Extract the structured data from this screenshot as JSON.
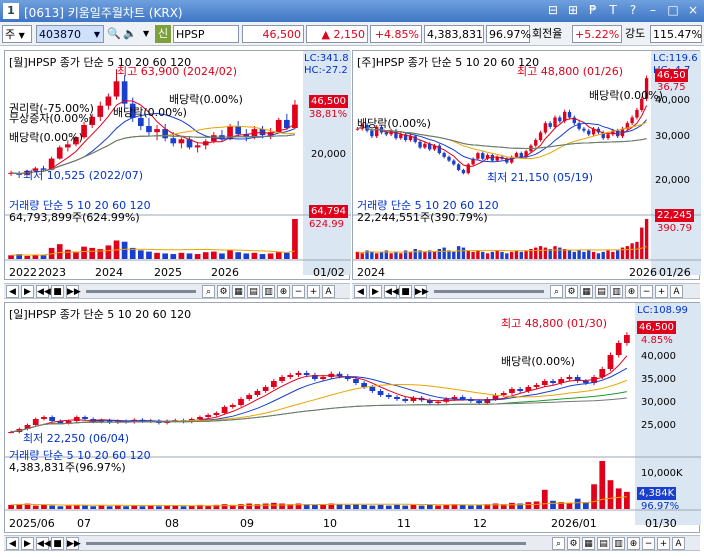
{
  "window": {
    "number": "1",
    "title": "[0613] 키움일주월차트 (KRX)",
    "buttons": [
      "⊟",
      "⊞",
      "₱",
      "T",
      "?",
      "–",
      "□",
      "×"
    ]
  },
  "toolbar": {
    "mode": "주",
    "code": "403870",
    "credit_badge": "신",
    "stock_name": "HPSP",
    "price": "46,500",
    "change": "2,150",
    "change_pct": "+4.85%",
    "volume": "4,383,831",
    "volume_ratio": "96.97%",
    "turnover_label": "회전율",
    "turnover": "+5.22%",
    "strength_label": "강도",
    "strength": "115.47%"
  },
  "monthly": {
    "header": "[월]HPSP 종가 단순 5 10 20 60 120",
    "high_label": "최고 63,900 (2024/02)",
    "low_label": "최저 10,525 (2022/07)",
    "dividend_labels": [
      "배당락(0.00%)",
      "배당락(0.00%)"
    ],
    "left_labels": [
      "권리락(-75.00%)",
      "무상증자(0.00%)",
      "배당락(0.00%)"
    ],
    "lc": "LC:341.8",
    "hc": "HC:-27.2",
    "price_tag": "46,500",
    "pct_tag": "38,81%",
    "y_ticks": [
      "20,000"
    ],
    "vol_header": "거래량 단순 5 10 20 60 120",
    "vol_value": "64,793,899주(624.99%)",
    "vol_tag": "64,794",
    "vol_pct_tag": "624.99",
    "x_ticks": [
      "2022",
      "2023",
      "2024",
      "2025",
      "2026"
    ],
    "date": "01/02",
    "candles": [
      {
        "o": 12500,
        "h": 14000,
        "l": 11500,
        "c": 13000
      },
      {
        "o": 13000,
        "h": 13800,
        "l": 10525,
        "c": 12000
      },
      {
        "o": 12000,
        "h": 14500,
        "l": 11800,
        "c": 14000
      },
      {
        "o": 14000,
        "h": 16000,
        "l": 13200,
        "c": 15200
      },
      {
        "o": 15200,
        "h": 16500,
        "l": 14000,
        "c": 14500
      },
      {
        "o": 14500,
        "h": 21000,
        "l": 14200,
        "c": 20000
      },
      {
        "o": 20000,
        "h": 26500,
        "l": 19500,
        "c": 25500
      },
      {
        "o": 25500,
        "h": 29000,
        "l": 23500,
        "c": 27000
      },
      {
        "o": 27000,
        "h": 31000,
        "l": 26000,
        "c": 30500
      },
      {
        "o": 30500,
        "h": 38000,
        "l": 29800,
        "c": 36500
      },
      {
        "o": 36500,
        "h": 42000,
        "l": 35000,
        "c": 40500
      },
      {
        "o": 40500,
        "h": 48000,
        "l": 38500,
        "c": 46000
      },
      {
        "o": 46000,
        "h": 52000,
        "l": 44000,
        "c": 50500
      },
      {
        "o": 50500,
        "h": 63900,
        "l": 49000,
        "c": 58000
      },
      {
        "o": 58000,
        "h": 61000,
        "l": 45000,
        "c": 47000
      },
      {
        "o": 47000,
        "h": 50000,
        "l": 38000,
        "c": 40000
      },
      {
        "o": 40000,
        "h": 43000,
        "l": 34000,
        "c": 36000
      },
      {
        "o": 36000,
        "h": 40000,
        "l": 31000,
        "c": 33000
      },
      {
        "o": 33000,
        "h": 36500,
        "l": 29000,
        "c": 34500
      },
      {
        "o": 34500,
        "h": 37000,
        "l": 28500,
        "c": 30000
      },
      {
        "o": 30000,
        "h": 33000,
        "l": 26000,
        "c": 27500
      },
      {
        "o": 27500,
        "h": 30500,
        "l": 25000,
        "c": 29500
      },
      {
        "o": 29500,
        "h": 31000,
        "l": 24500,
        "c": 25500
      },
      {
        "o": 25500,
        "h": 28000,
        "l": 23000,
        "c": 26500
      },
      {
        "o": 26500,
        "h": 29500,
        "l": 24500,
        "c": 28500
      },
      {
        "o": 28500,
        "h": 33000,
        "l": 27500,
        "c": 31500
      },
      {
        "o": 31500,
        "h": 34000,
        "l": 28500,
        "c": 29500
      },
      {
        "o": 29500,
        "h": 37000,
        "l": 29000,
        "c": 36000
      },
      {
        "o": 36000,
        "h": 38500,
        "l": 31000,
        "c": 32000
      },
      {
        "o": 32000,
        "h": 34500,
        "l": 28500,
        "c": 30500
      },
      {
        "o": 30500,
        "h": 36000,
        "l": 29500,
        "c": 34500
      },
      {
        "o": 34500,
        "h": 36000,
        "l": 30000,
        "c": 31500
      },
      {
        "o": 31500,
        "h": 35000,
        "l": 29500,
        "c": 33000
      },
      {
        "o": 33000,
        "h": 40000,
        "l": 32500,
        "c": 39000
      },
      {
        "o": 39000,
        "h": 42000,
        "l": 34000,
        "c": 35000
      },
      {
        "o": 35000,
        "h": 48800,
        "l": 34500,
        "c": 46500
      }
    ],
    "volumes": [
      6,
      8,
      5,
      7,
      6,
      18,
      24,
      15,
      12,
      20,
      18,
      16,
      22,
      30,
      28,
      18,
      14,
      12,
      10,
      9,
      8,
      10,
      9,
      8,
      11,
      12,
      9,
      14,
      11,
      9,
      10,
      8,
      9,
      12,
      10,
      64.8
    ]
  },
  "weekly": {
    "header": "[주]HPSP 종가 단순 5 10 20 60 120",
    "high_label": "최고 48,800 (01/26)",
    "low_label": "최저 21,150 (05/19)",
    "dividend_labels": [
      "배당락(0.00%)",
      "배당락(0.00%)"
    ],
    "lc": "LC:119.6",
    "hc": "HC:-4.7",
    "price_tag": "46,50",
    "pct_tag": "36,75",
    "y_ticks": [
      "40,000",
      "30,000",
      "20,000"
    ],
    "vol_header": "거래량 단순 5 10 20 60 120",
    "vol_value": "22,244,551주(390.79%)",
    "vol_tag": "22,245",
    "vol_pct_tag": "390.79",
    "x_ticks": [
      "2024",
      "2026"
    ],
    "date": "01/26",
    "closes": [
      33000,
      34000,
      32500,
      31000,
      33500,
      32000,
      31500,
      32500,
      30500,
      31500,
      30000,
      31000,
      29500,
      28000,
      29000,
      27500,
      28500,
      26500,
      25500,
      24500,
      23500,
      22000,
      21150,
      23500,
      25000,
      26500,
      25000,
      26000,
      24500,
      25500,
      25000,
      24000,
      25500,
      26500,
      25500,
      27000,
      28500,
      30000,
      32000,
      34500,
      33500,
      36000,
      35000,
      37500,
      36000,
      34500,
      33000,
      32500,
      31500,
      33000,
      32000,
      30500,
      31500,
      32500,
      31000,
      33000,
      34500,
      36000,
      38000,
      41000,
      46500
    ],
    "volumes": [
      5,
      4,
      6,
      5,
      4,
      5,
      6,
      4,
      5,
      4,
      6,
      5,
      7,
      6,
      5,
      6,
      5,
      7,
      8,
      6,
      5,
      9,
      8,
      6,
      5,
      6,
      5,
      4,
      5,
      6,
      5,
      4,
      5,
      6,
      5,
      6,
      7,
      8,
      9,
      8,
      7,
      9,
      8,
      7,
      6,
      5,
      6,
      5,
      6,
      5,
      4,
      5,
      6,
      5,
      6,
      8,
      9,
      11,
      12,
      22,
      28
    ]
  },
  "daily": {
    "header": "[일]HPSP 종가 단순 5 10 20 60 120",
    "high_label": "최고 48,800 (01/30)",
    "low_label": "최저 22,250 (06/04)",
    "dividend_labels": [
      "배당락(0.00%)"
    ],
    "lc": "LC:108.99",
    "price_tag": "46,500",
    "pct_tag": "4.85%",
    "y_ticks": [
      "40,000",
      "35,000",
      "30,000",
      "25,000"
    ],
    "vol_header": "거래량 단순 5 10 20 60 120",
    "vol_value": "4,383,831주(96.97%)",
    "vol_ticks": [
      "10,000K"
    ],
    "vol_tag": "4,384K",
    "vol_pct_tag": "96.97%",
    "x_ticks": [
      "2025/06",
      "07",
      "08",
      "09",
      "10",
      "11",
      "12",
      "2026/01"
    ],
    "date": "01/30",
    "closes": [
      22250,
      23000,
      24000,
      25500,
      26000,
      25000,
      24500,
      25000,
      26000,
      25500,
      24800,
      25200,
      24600,
      25000,
      24700,
      25300,
      24900,
      25100,
      24500,
      25000,
      25200,
      24800,
      25500,
      26000,
      26500,
      27000,
      28500,
      29000,
      30500,
      31500,
      32500,
      33500,
      35000,
      36000,
      36500,
      37000,
      36500,
      35500,
      36000,
      36800,
      36200,
      35500,
      34500,
      33500,
      32500,
      31500,
      31000,
      30500,
      30000,
      30800,
      30200,
      29500,
      29800,
      30500,
      31000,
      30500,
      30000,
      29500,
      30500,
      31500,
      32000,
      33000,
      32500,
      33500,
      34000,
      35000,
      34500,
      35500,
      36000,
      35000,
      34500,
      36000,
      38000,
      41500,
      44500,
      46500
    ],
    "volumes": [
      6,
      7,
      8,
      5,
      6,
      5,
      4,
      5,
      6,
      5,
      4,
      5,
      4,
      5,
      4,
      5,
      4,
      5,
      4,
      5,
      5,
      4,
      5,
      6,
      5,
      6,
      7,
      6,
      7,
      8,
      7,
      8,
      9,
      8,
      7,
      8,
      7,
      6,
      7,
      8,
      7,
      6,
      7,
      6,
      5,
      6,
      5,
      6,
      5,
      6,
      5,
      6,
      5,
      6,
      7,
      6,
      5,
      6,
      7,
      8,
      7,
      9,
      8,
      10,
      11,
      28,
      12,
      10,
      9,
      15,
      10,
      36,
      70,
      42,
      30,
      25
    ]
  }
}
